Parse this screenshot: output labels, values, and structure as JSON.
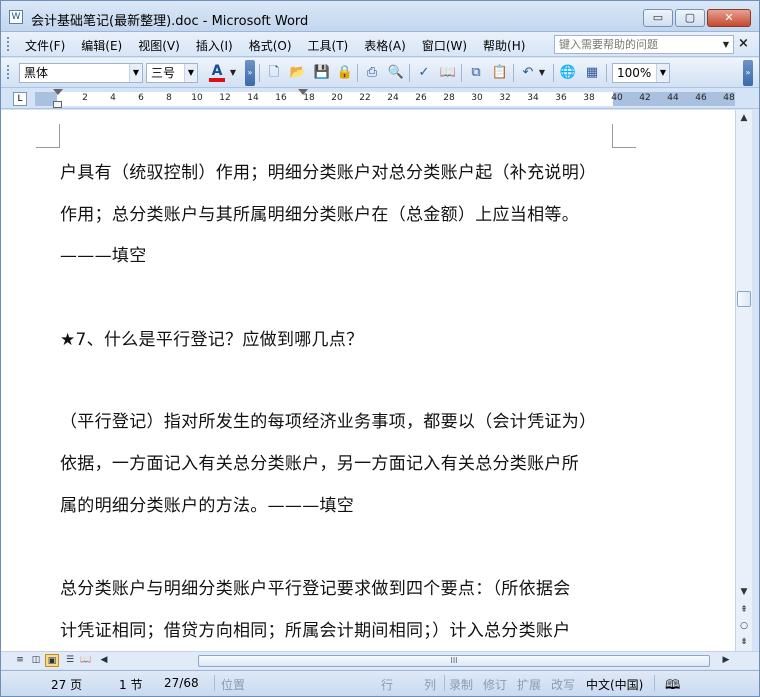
{
  "window": {
    "title": "会计基础笔记(最新整理).doc - Microsoft Word",
    "icon_label": "W"
  },
  "window_controls": {
    "minimize": "▭",
    "maximize": "▢",
    "close": "✕"
  },
  "menu": {
    "items": [
      "文件(F)",
      "编辑(E)",
      "视图(V)",
      "插入(I)",
      "格式(O)",
      "工具(T)",
      "表格(A)",
      "窗口(W)",
      "帮助(H)"
    ],
    "help_placeholder": "键入需要帮助的问题",
    "close_glyph": "×"
  },
  "toolbar": {
    "font_name": "黑体",
    "font_size": "三号",
    "font_color_glyph": "A",
    "font_color": "#e01010",
    "zoom": "100%",
    "icons": [
      "new-document-icon",
      "open-icon",
      "save-icon",
      "permission-icon",
      "print-icon",
      "print-preview-icon",
      "spelling-icon",
      "research-icon",
      "copy-icon",
      "paste-icon",
      "undo-icon",
      "hyperlink-icon",
      "table-icon"
    ]
  },
  "ruler": {
    "corner_glyph": "L",
    "numbers": [
      "2",
      "4",
      "6",
      "8",
      "10",
      "12",
      "14",
      "16",
      "18",
      "20",
      "22",
      "24",
      "26",
      "28",
      "30",
      "32",
      "34",
      "36",
      "38",
      "40",
      "42",
      "44",
      "46",
      "48"
    ]
  },
  "document": {
    "paragraphs": [
      "户具有（统驭控制）作用；明细分类账户对总分类账户起（补充说明）",
      "作用；总分类账户与其所属明细分类账户在（总金额）上应当相等。",
      "———填空",
      "★7、什么是平行登记？应做到哪几点？",
      "（平行登记）指对所发生的每项经济业务事项，都要以（会计凭证为）",
      "依据，一方面记入有关总分类账户，另一方面记入有关总分类账户所",
      "属的明细分类账户的方法。———填空",
      "总分类账户与明细分类账户平行登记要求做到四个要点：（所依据会",
      "计凭证相同；借贷方向相同；所属会计期间相同；）计入总分类账户"
    ]
  },
  "hscroll": {
    "thumb_grip": "III"
  },
  "status": {
    "page": "27 页",
    "section": "1 节",
    "page_of": "27/68",
    "position": "位置",
    "line": "行",
    "column": "列",
    "rec": "录制",
    "trk": "修订",
    "ext": "扩展",
    "ovr": "改写",
    "language": "中文(中国)"
  }
}
